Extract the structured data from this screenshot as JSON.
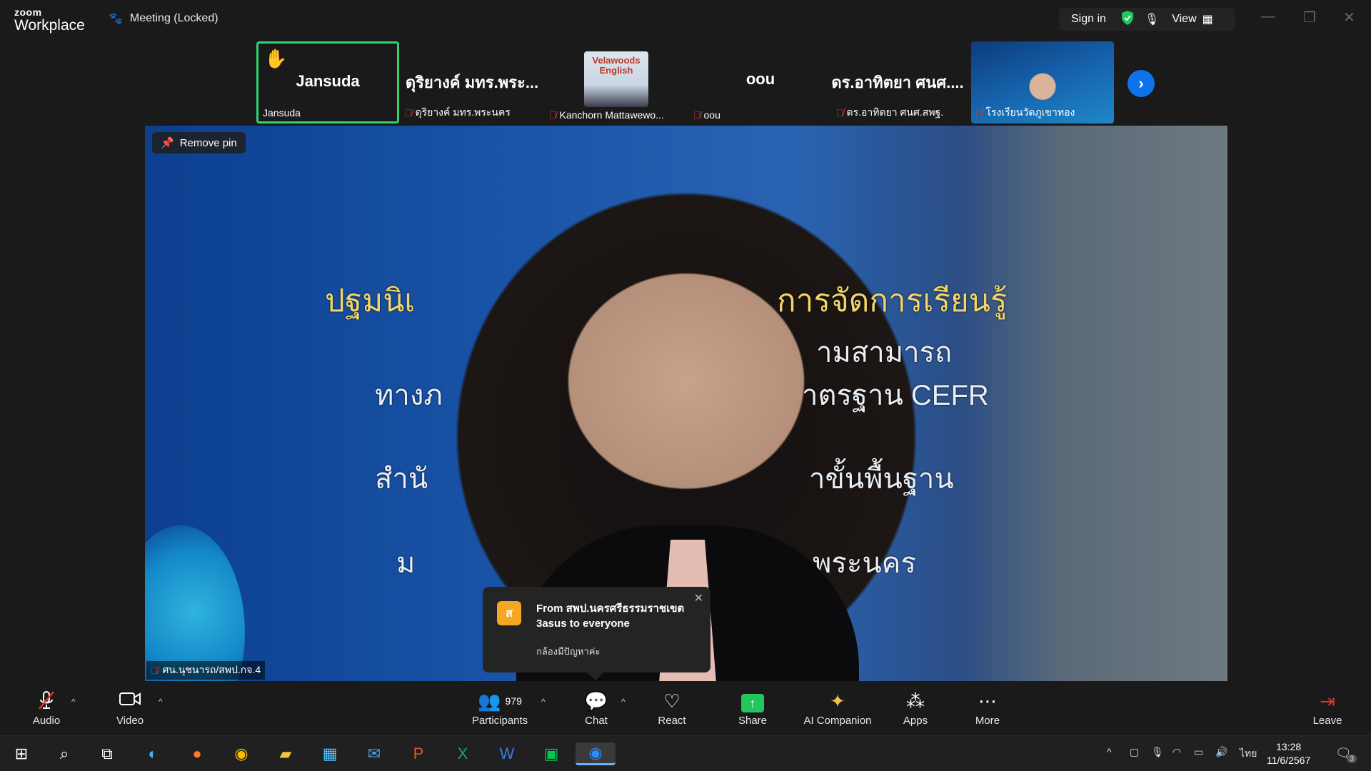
{
  "app": {
    "logo_small": "zoom",
    "logo_big": "Workplace",
    "meeting_title": "Meeting (Locked)",
    "sign_in": "Sign in",
    "view": "View"
  },
  "gallery": [
    {
      "center": "Jansuda",
      "label": "Jansuda",
      "muted": false,
      "hand_raised": true
    },
    {
      "center": "ดุริยางค์ มทร.พระ...",
      "label": "ดุริยางค์ มทร.พระนคร",
      "muted": true
    },
    {
      "center": "",
      "label": "Kanchorn Mattawewo...",
      "muted": true,
      "thumb_text": "Velawoods English"
    },
    {
      "center": "oou",
      "label": "oou",
      "muted": true
    },
    {
      "center": "ดร.อาทิตยา ศนศ....",
      "label": "ดร.อาทิตยา ศนศ.สพฐ.",
      "muted": true
    },
    {
      "center": "",
      "label": "โรงเรียนวัดภูเขาทอง",
      "muted": true
    }
  ],
  "main": {
    "remove_pin": "Remove pin",
    "speaker_name": "ศน.นุชนารถ/สพป.กจ.4",
    "slide_lines": [
      "ปฐมนิเ",
      "การจัดการเรียนรู้",
      "ามสามารถ",
      "ทางภ",
      "าตรฐาน CEFR",
      "สำนั",
      "าขั้นพื้นฐาน",
      "ม",
      "พระนคร"
    ]
  },
  "toast": {
    "avatar_letter": "ส",
    "from": "From สพป.นครศรีธรรมราชเขต 3asus to everyone",
    "message": "กล้องมีปัญหาค่ะ"
  },
  "toolbar": {
    "audio": "Audio",
    "video": "Video",
    "participants": "Participants",
    "participants_count": "979",
    "chat": "Chat",
    "react": "React",
    "share": "Share",
    "ai_companion": "AI Companion",
    "apps": "Apps",
    "more": "More",
    "leave": "Leave"
  },
  "taskbar": {
    "lang": "ไทย",
    "time": "13:28",
    "date": "11/6/2567",
    "notifications": "3"
  }
}
